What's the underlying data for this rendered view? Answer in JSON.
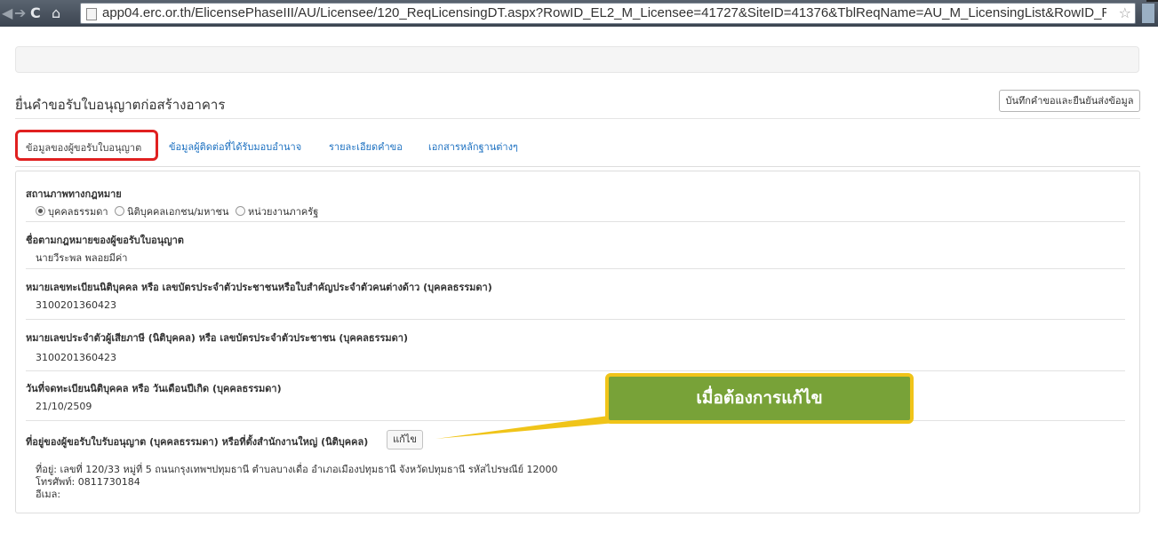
{
  "browser": {
    "url": "app04.erc.or.th/ElicensePhaseIII/AU/Licensee/120_ReqLicensingDT.aspx?RowID_EL2_M_Licensee=41727&SiteID=41376&TblReqName=AU_M_LicensingList&RowID_ReqNa"
  },
  "page": {
    "title": "ยื่นคำขอรับใบอนุญาตก่อสร้างอาคาร",
    "save_button": "บันทึกคำขอและยืนยันส่งข้อมูล"
  },
  "tabs": [
    {
      "label": "ข้อมูลของผู้ขอรับใบอนุญาต",
      "active": true
    },
    {
      "label": "ข้อมูลผู้ติดต่อที่ได้รับมอบอำนาจ",
      "active": false
    },
    {
      "label": "รายละเอียดคำขอ",
      "active": false
    },
    {
      "label": "เอกสารหลักฐานต่างๆ",
      "active": false
    }
  ],
  "form": {
    "legal_status": {
      "label": "สถานภาพทางกฎหมาย",
      "options": [
        "บุคคลธรรมดา",
        "นิติบุคคลเอกชน/มหาชน",
        "หน่วยงานภาครัฐ"
      ],
      "selected": "บุคคลธรรมดา"
    },
    "legal_name": {
      "label": "ชื่อตามกฎหมายของผู้ขอรับใบอนุญาต",
      "value": "นายวีระพล พลอยมีค่า"
    },
    "registration_no": {
      "label": "หมายเลขทะเบียนนิติบุคคล หรือ เลขบัตรประจำตัวประชาชนหรือใบสำคัญประจำตัวคนต่างด้าว (บุคคลธรรมดา)",
      "value": "3100201360423"
    },
    "tax_id": {
      "label": "หมายเลขประจำตัวผู้เสียภาษี (นิติบุคคล) หรือ เลขบัตรประจำตัวประชาชน (บุคคลธรรมดา)",
      "value": "3100201360423"
    },
    "birth_date": {
      "label": "วันที่จดทะเบียนนิติบุคคล หรือ วันเดือนปีเกิด (บุคคลธรรมดา)",
      "value": "21/10/2509"
    },
    "address": {
      "label": "ที่อยู่ของผู้ขอรับใบรับอนุญาต (บุคคลธรรมดา) หรือที่ตั้งสำนักงานใหญ่ (นิติบุคคล)",
      "edit_label": "แก้ไข",
      "address_line": "ที่อยู่: เลขที่ 120/33 หมู่ที่ 5 ถนนกรุงเทพฯปทุมธานี ตำบลบางเดื่อ อำเภอเมืองปทุมธานี จังหวัดปทุมธานี รหัสไปรษณีย์ 12000",
      "phone_line": "โทรศัพท์: 0811730184",
      "email_line": "อีเมล:"
    }
  },
  "annotation": {
    "callout_text": "เมื่อต้องการแก้ไข",
    "callout_fill": "#78a238",
    "callout_border": "#f0c419",
    "highlight_color": "#e02020"
  }
}
